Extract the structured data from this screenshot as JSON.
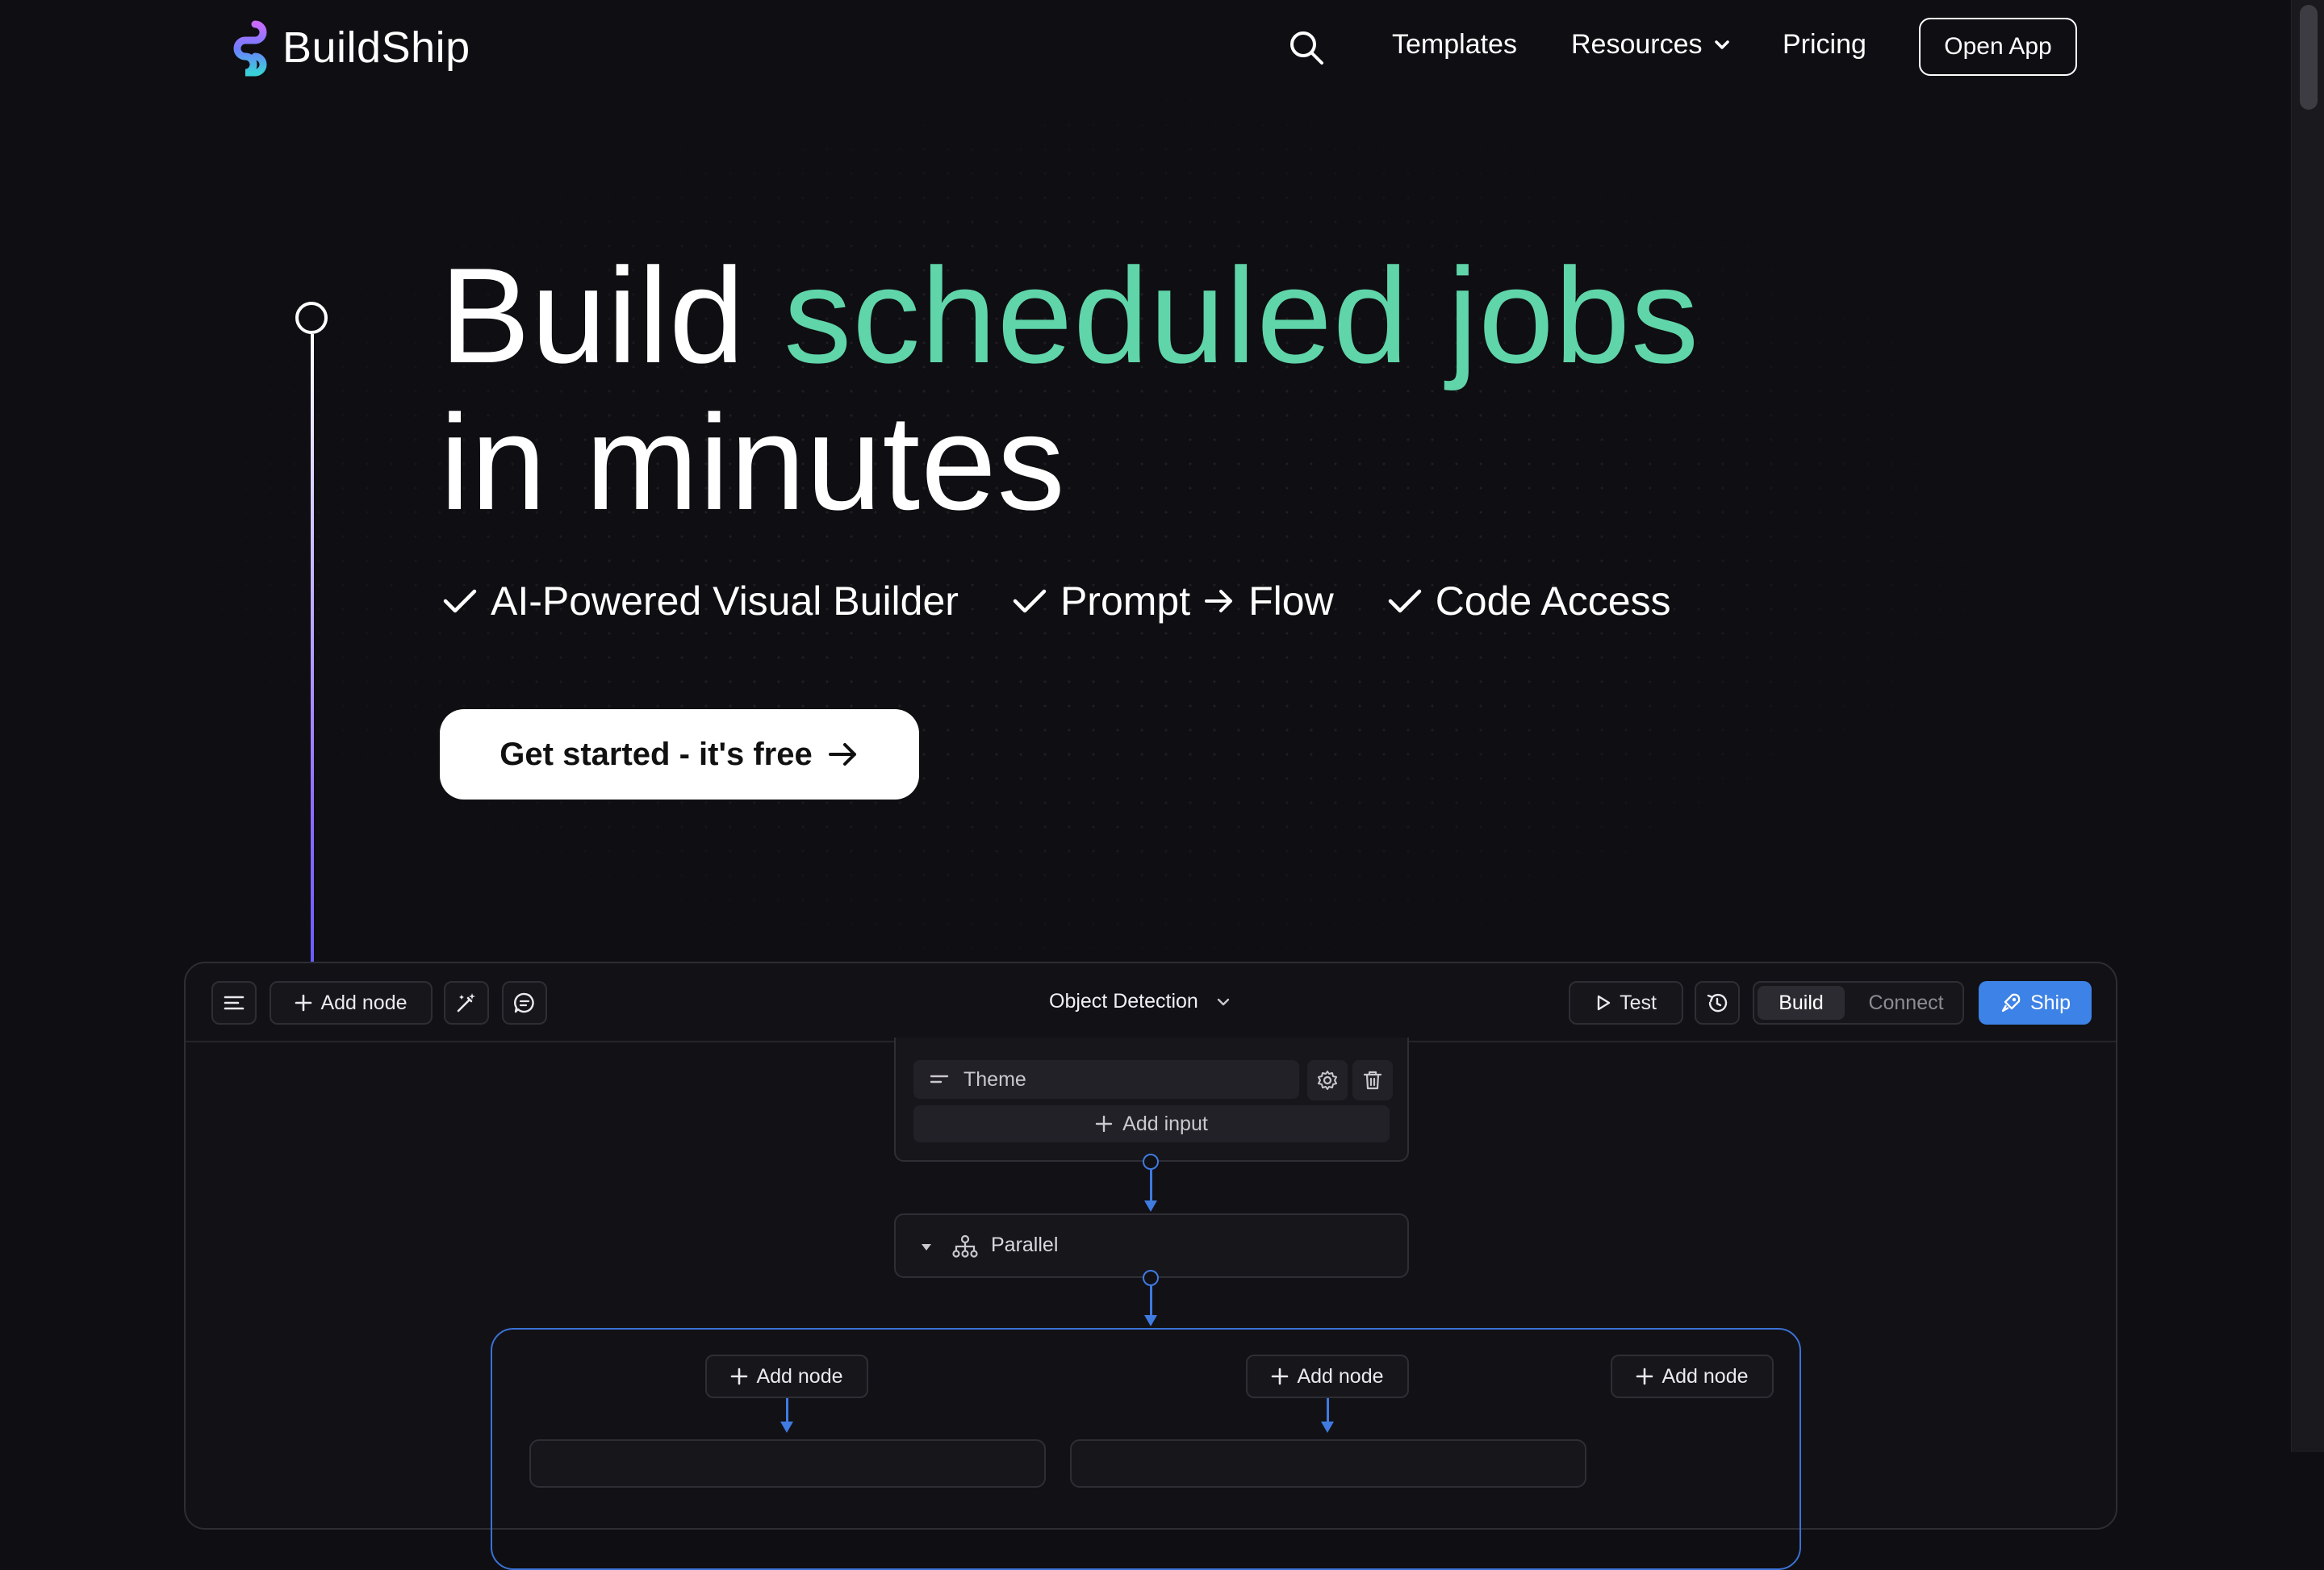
{
  "nav": {
    "brand": "BuildShip",
    "links": {
      "templates": "Templates",
      "resources": "Resources",
      "pricing": "Pricing"
    },
    "open_app": "Open App"
  },
  "hero": {
    "title_part1": "Build",
    "title_accent": "scheduled jobs",
    "title_part2": "in minutes",
    "accent_color": "#5fd5a9",
    "features": [
      "AI-Powered Visual Builder",
      "Prompt",
      "Flow",
      "Code Access"
    ],
    "cta": "Get started - it's free"
  },
  "app": {
    "toolbar": {
      "add_node": "Add node",
      "flow_name": "Object Detection",
      "test": "Test",
      "build": "Build",
      "connect": "Connect",
      "ship": "Ship"
    },
    "input_node": {
      "field_label": "Theme",
      "add_input": "Add input"
    },
    "parallel_node": {
      "label": "Parallel"
    },
    "branches": [
      "Add node",
      "Add node",
      "Add node"
    ],
    "accent_color": "#3d82e6"
  }
}
